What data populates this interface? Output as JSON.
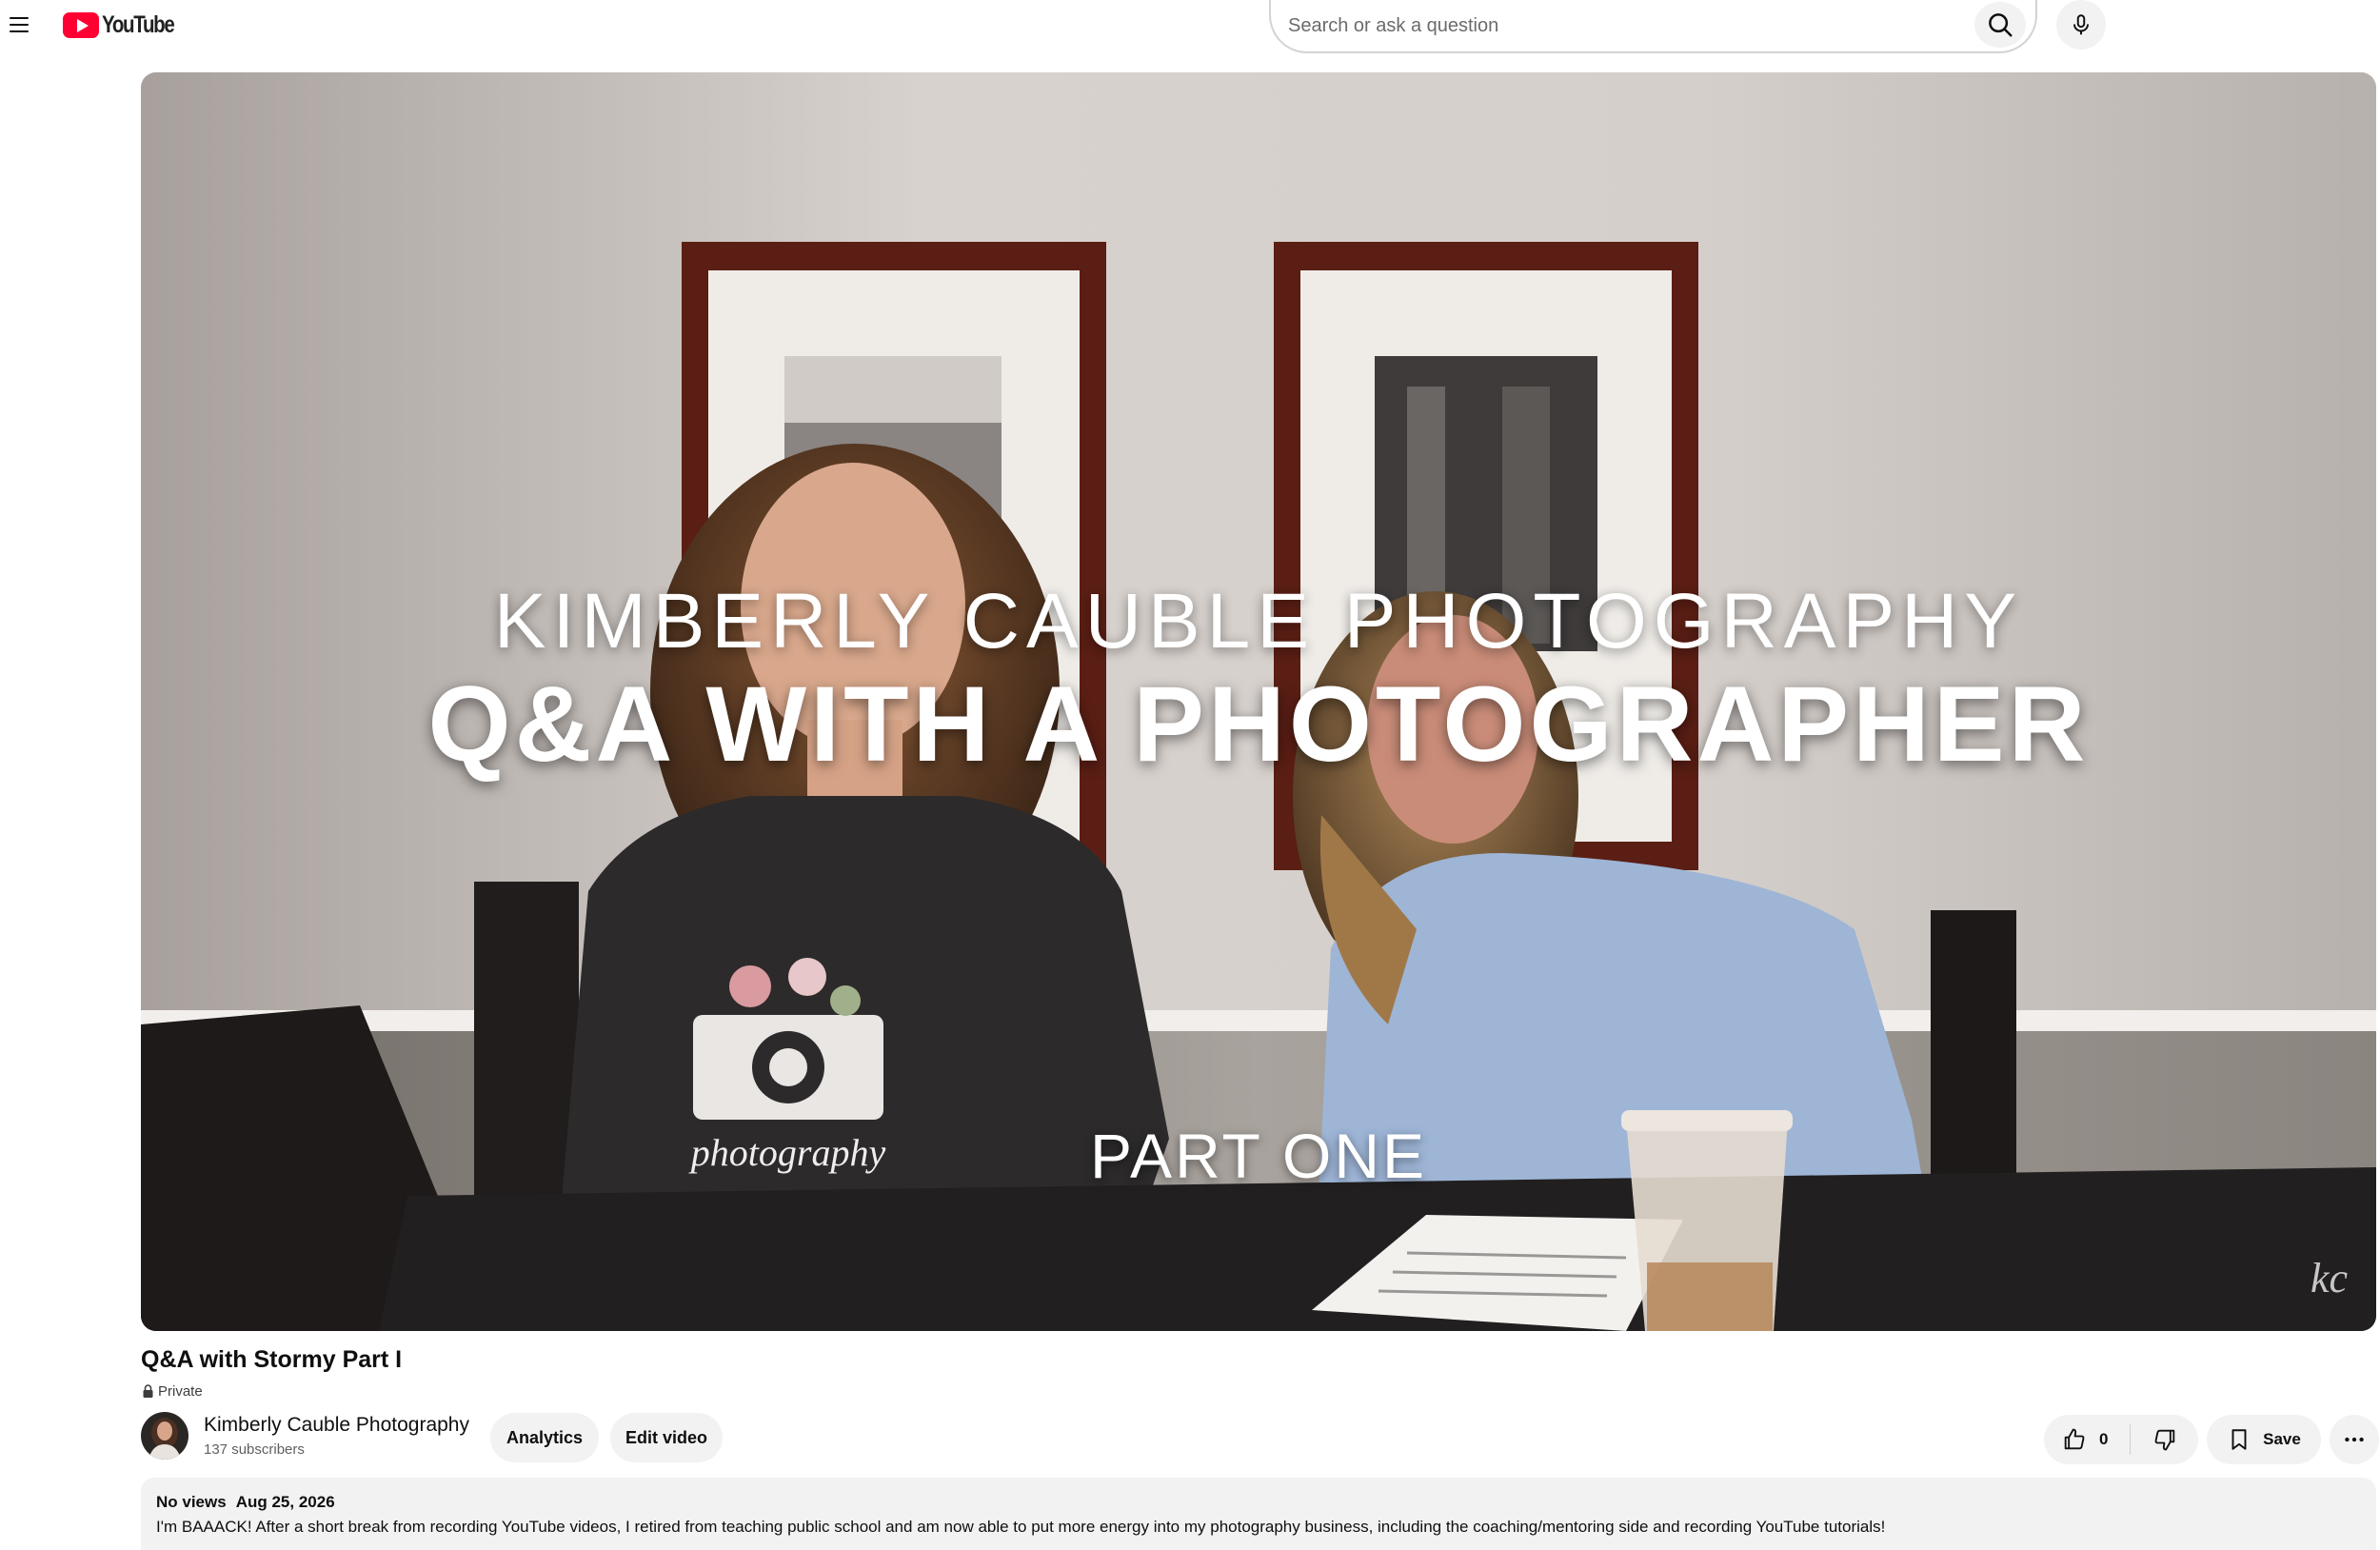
{
  "header": {
    "logo_text": "YouTube",
    "search_placeholder": "Search or ask a question"
  },
  "video": {
    "overlay_brand": "KIMBERLY CAUBLE PHOTOGRAPHY",
    "overlay_title": "Q&A WITH A PHOTOGRAPHER",
    "overlay_part": "PART ONE",
    "shirt_print": "photography",
    "watermark": "kc"
  },
  "meta": {
    "title": "Q&A with Stormy Part I",
    "privacy": "Private"
  },
  "channel": {
    "name": "Kimberly Cauble Photography",
    "subscribers": "137 subscribers"
  },
  "actions": {
    "analytics": "Analytics",
    "edit_video": "Edit video",
    "like_count": "0",
    "save": "Save"
  },
  "description": {
    "views": "No views",
    "date": "Aug 25, 2026",
    "text": "I'm BAAACK!  After a short break from recording YouTube videos, I retired from teaching public school and am now able to put more energy into my photography business, including the coaching/mentoring side and recording YouTube tutorials!"
  },
  "icons": [
    "menu-icon",
    "youtube-logo-icon",
    "search-icon",
    "mic-icon",
    "lock-icon",
    "thumbs-up-icon",
    "thumbs-down-icon",
    "bookmark-icon",
    "more-horiz-icon"
  ],
  "colors": {
    "brand_red": "#ff0033",
    "pill_bg": "#f2f2f2",
    "text_primary": "#0f0f0f",
    "text_secondary": "#606060"
  }
}
